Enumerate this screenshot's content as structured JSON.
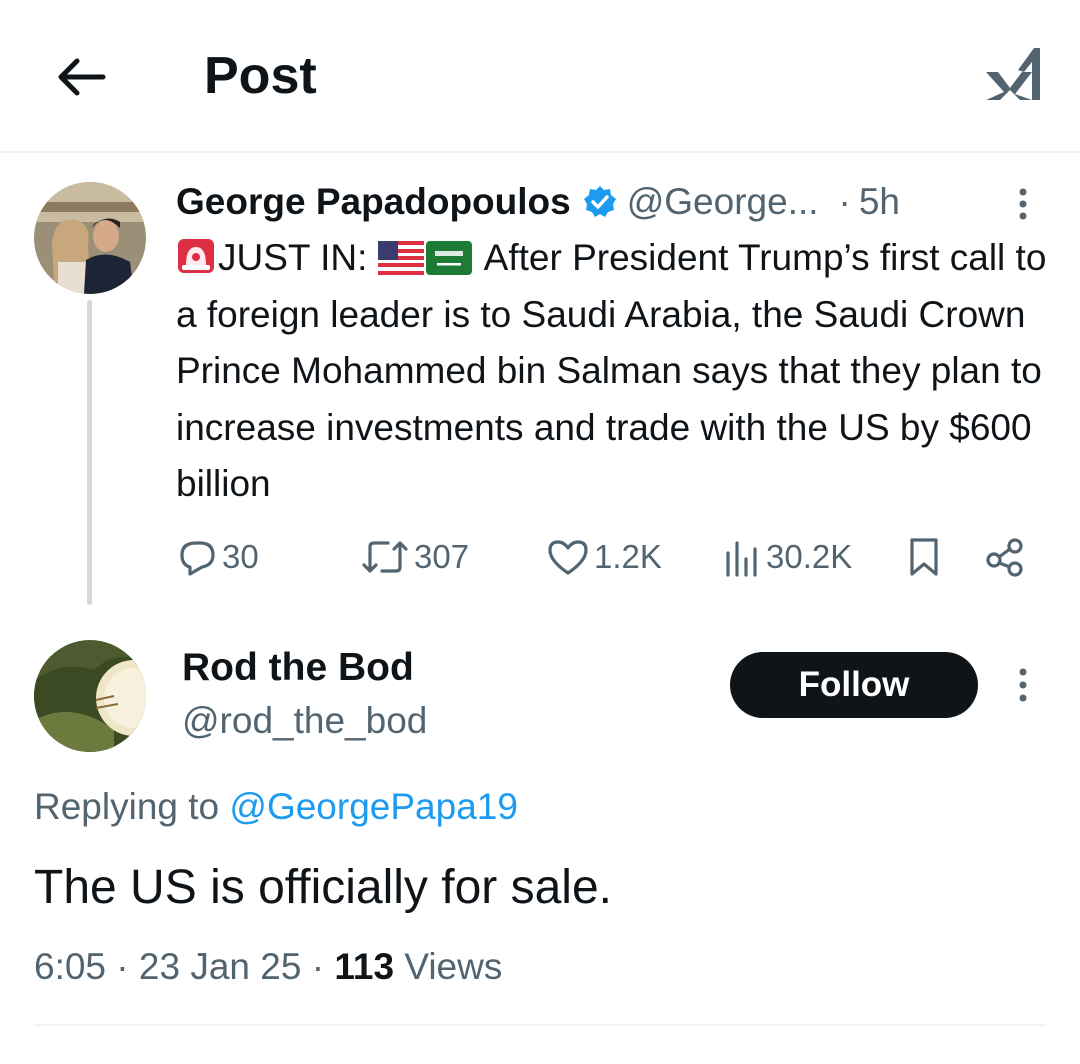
{
  "header": {
    "title": "Post",
    "back_icon": "arrow-left-icon",
    "logo_icon": "x-logo-icon"
  },
  "parent_tweet": {
    "author_name": "George Papadopoulos",
    "verified": true,
    "handle": "@George...",
    "separator": "·",
    "age": "5h",
    "text_prefix": "JUST IN: ",
    "emoji": [
      "police-light-emoji",
      "us-flag-emoji",
      "saudi-flag-emoji"
    ],
    "text_body": "After President Trump’s first call to a foreign leader is to Saudi Arabia, the Saudi Crown Prince Mohammed bin Salman says that they plan to increase investments and trade with the US by $600 billion",
    "stats": {
      "replies": "30",
      "reposts": "307",
      "likes": "1.2K",
      "views": "30.2K"
    }
  },
  "reply": {
    "author_name": "Rod the Bod",
    "handle": "@rod_the_bod",
    "follow_label": "Follow",
    "replying_label": "Replying to",
    "replying_to": "@GeorgePapa19",
    "text": "The US is officially for sale.",
    "time": "6:05",
    "date": "23 Jan 25",
    "views_count": "113",
    "views_label": "Views",
    "sep": "·"
  },
  "colors": {
    "text": "#0f1419",
    "muted": "#536471",
    "link": "#1d9bf0",
    "divider": "#eff3f4",
    "button": "#0f1419"
  }
}
